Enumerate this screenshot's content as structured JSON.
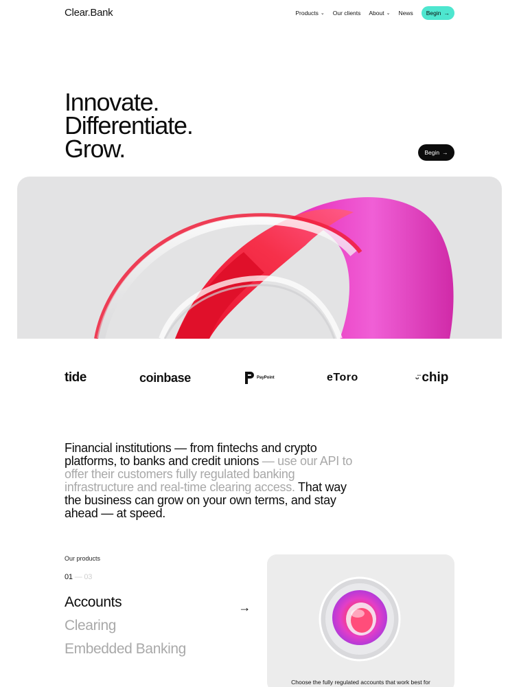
{
  "header": {
    "logo": "Clear.Bank",
    "nav": [
      {
        "label": "Products",
        "has_dropdown": true
      },
      {
        "label": "Our clients",
        "has_dropdown": false
      },
      {
        "label": "About",
        "has_dropdown": true
      },
      {
        "label": "News",
        "has_dropdown": false
      }
    ],
    "cta": "Begin",
    "cta_color": "#4ee6cf"
  },
  "hero": {
    "lines": [
      "Innovate.",
      "Differentiate.",
      "Grow."
    ],
    "cta": "Begin"
  },
  "clients": [
    "tide",
    "coinbase",
    "PayPoint",
    "eToro",
    "chip"
  ],
  "statement": {
    "part1": "Financial institutions — from fintechs and crypto platforms, to banks and credit unions",
    "part2": " — use our API to offer their customers fully regulated banking infrastructure and real-time clearing access.",
    "part3": " That way the business can grow on your own terms, and stay ahead — at speed."
  },
  "products": {
    "label": "Our products",
    "counter_current": "01",
    "counter_sep": " — ",
    "counter_total": "03",
    "items": [
      "Accounts",
      "Clearing",
      "Embedded Banking"
    ],
    "card_caption": "Choose the fully regulated accounts that work best for"
  },
  "colors": {
    "accent": "#4ee6cf",
    "ribbon_red": "#f0203c",
    "ribbon_pink": "#ef4fd0"
  }
}
